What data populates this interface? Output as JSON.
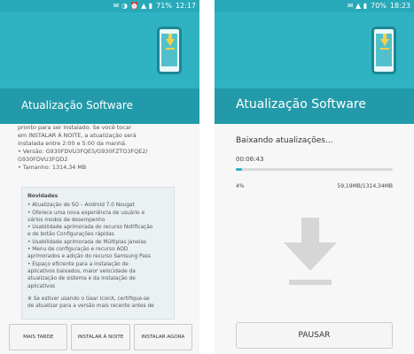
{
  "left": {
    "status": {
      "icons_text": "✉ ◑ ⏰ ▲ ▮",
      "battery": "71%",
      "time": "12:17"
    },
    "title": "Atualização Software",
    "body_lines": [
      "pronto para ser instalado. Se você tocar",
      "em INSTALAR À NOITE, a atualização será",
      "instalada entre 2:00 e 5:00 da manhã.",
      "• Versão: G930FDVU3FQE5/G930FZTO3FQE2/",
      "G930FDVU3FQD2",
      "• Tamanho: 1314,34 MB"
    ],
    "novidades": {
      "header": "Novidades",
      "items": [
        "• Atualização de SO – Android 7.0 Nougat",
        "• Oferece uma nova experiência de usuário e",
        "  vários modos de desempenho",
        "• Usabilidade aprimorada do recurso Notificação",
        "  e de botão Configurações rápidas",
        "• Usabilidade aprimorada de Múltiplas janelas",
        "• Menu de configuração e recurso AOD",
        "  aprimorados e adição do recurso Samsung Pass",
        "• Espaço eficiente para a instalação de",
        "  aplicativos baixados, maior velocidade da",
        "  atualização de sistema e da instalação de",
        "  aplicativos",
        "",
        "※ Se estiver usando o Gear IconX, certifique-se",
        "  de atualizar para a versão mais recente antes de"
      ]
    },
    "buttons": {
      "later": "MAIS TARDE",
      "night": "INSTALAR À NOITE",
      "now": "INSTALAR AGORA"
    }
  },
  "right": {
    "status": {
      "icons_text": "✉ ▲ ▮",
      "battery": "70%",
      "time": "18:23"
    },
    "title": "Atualização Software",
    "download_label": "Baixando atualizações...",
    "elapsed": "00:06:43",
    "percent": "4%",
    "progress_fraction": 0.04,
    "size": "59,19MB/1314,34MB",
    "pause": "PAUSAR"
  }
}
